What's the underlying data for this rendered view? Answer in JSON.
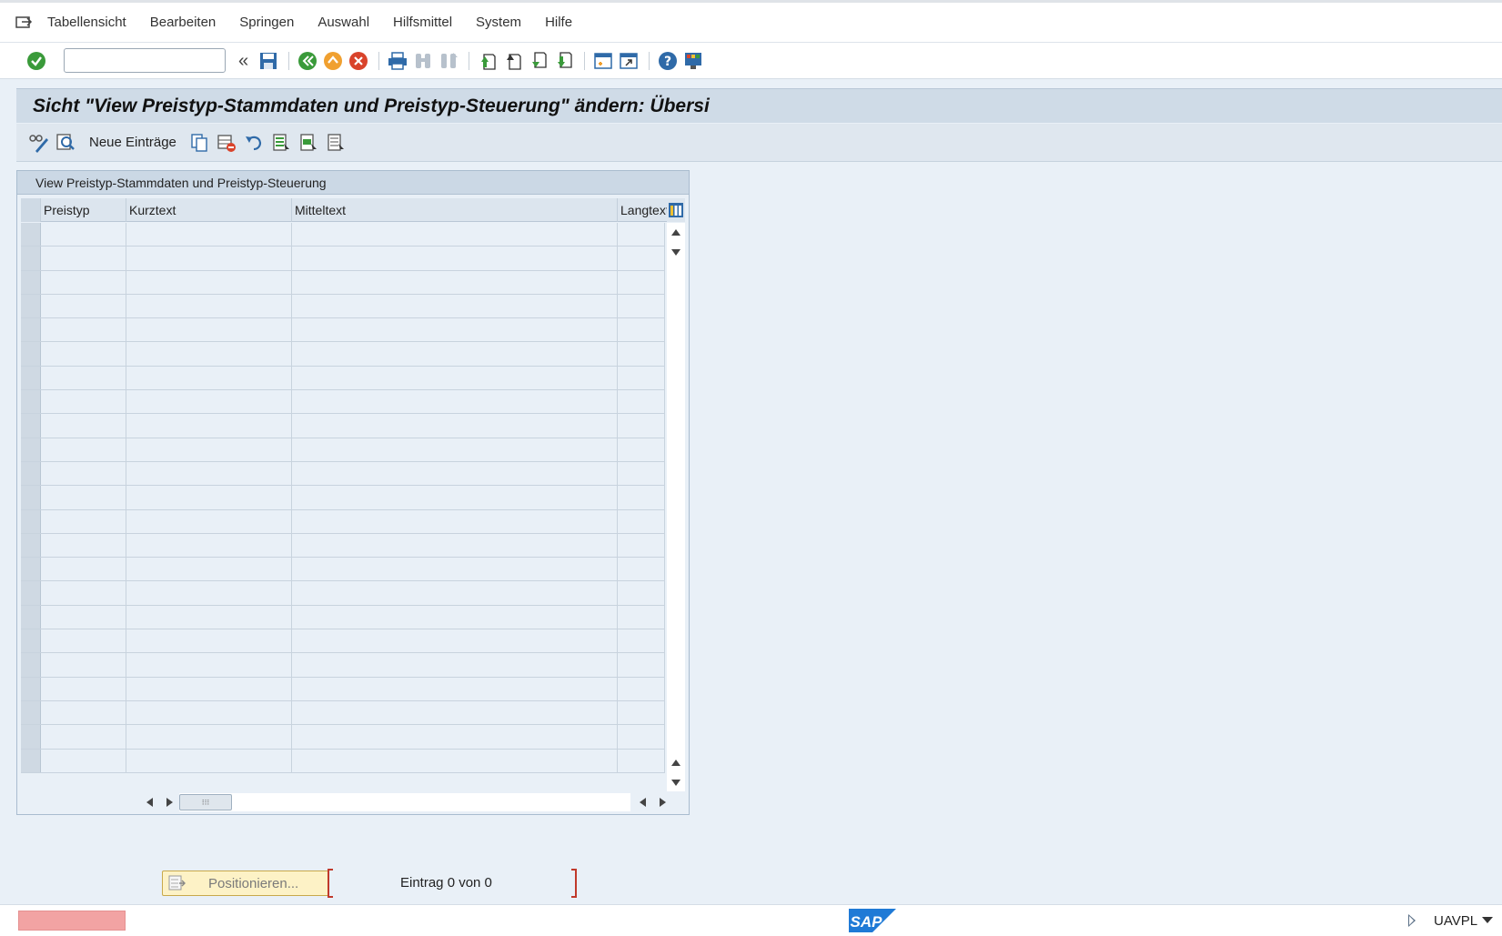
{
  "menubar": {
    "items": [
      "Tabellensicht",
      "Bearbeiten",
      "Springen",
      "Auswahl",
      "Hilfsmittel",
      "System",
      "Hilfe"
    ]
  },
  "toolbar": {
    "command_value": "",
    "back_symbol": "«"
  },
  "title": "Sicht \"View Preistyp-Stammdaten und Preistyp-Steuerung\" ändern: Übersi",
  "apptoolbar": {
    "new_entries_label": "Neue Einträge"
  },
  "table": {
    "title": "View Preistyp-Stammdaten und Preistyp-Steuerung",
    "columns": [
      "Preistyp",
      "Kurztext",
      "Mitteltext",
      "Langtext"
    ],
    "rows": []
  },
  "positioner": {
    "button_label": "Positionieren...",
    "entry_text": "Eintrag 0 von 0"
  },
  "status": {
    "system": "UAVPL",
    "logo_text": "SAP"
  },
  "colors": {
    "accept_green": "#3a9a3a",
    "exit_orange": "#f0a030",
    "cancel_red": "#d9432b",
    "save_blue": "#2f6aa8",
    "status_error": "#f2a3a3"
  }
}
